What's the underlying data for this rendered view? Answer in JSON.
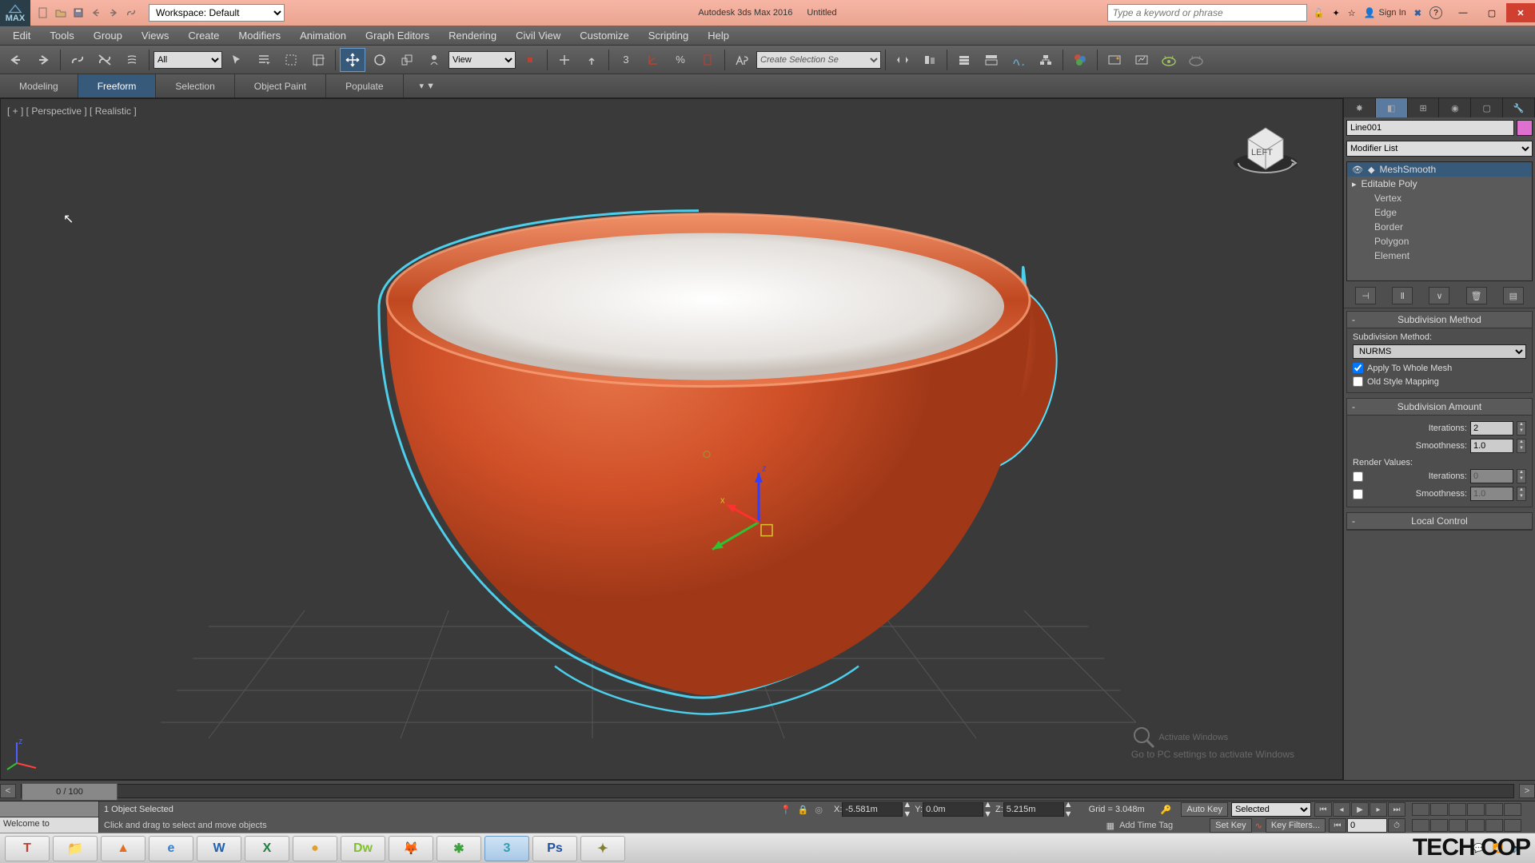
{
  "app": {
    "name": "Autodesk 3ds Max 2016",
    "doc": "Untitled",
    "logo": "MAX"
  },
  "workspace": {
    "label": "Workspace: Default"
  },
  "search": {
    "placeholder": "Type a keyword or phrase"
  },
  "signin": "Sign In",
  "menus": [
    "Edit",
    "Tools",
    "Group",
    "Views",
    "Create",
    "Modifiers",
    "Animation",
    "Graph Editors",
    "Rendering",
    "Civil View",
    "Customize",
    "Scripting",
    "Help"
  ],
  "toolbar": {
    "filter": "All",
    "refcoord": "View",
    "selset": "Create Selection Se"
  },
  "ribbon": [
    "Modeling",
    "Freeform",
    "Selection",
    "Object Paint",
    "Populate"
  ],
  "ribbon_active": 1,
  "viewport": {
    "label": "[ + ] [ Perspective ] [ Realistic ]"
  },
  "activate": {
    "title": "Activate Windows",
    "sub": "Go to PC settings to activate Windows"
  },
  "cpanel": {
    "object": "Line001",
    "modlist": "Modifier List",
    "stack": [
      {
        "label": "MeshSmooth",
        "sel": true,
        "eye": true
      },
      {
        "label": "Editable Poly",
        "expand": true
      },
      {
        "label": "Vertex",
        "sub": true
      },
      {
        "label": "Edge",
        "sub": true
      },
      {
        "label": "Border",
        "sub": true
      },
      {
        "label": "Polygon",
        "sub": true
      },
      {
        "label": "Element",
        "sub": true
      }
    ],
    "subdiv_method": {
      "title": "Subdivision Method",
      "label": "Subdivision Method:",
      "value": "NURMS",
      "apply": "Apply To Whole Mesh",
      "oldstyle": "Old Style Mapping"
    },
    "subdiv_amount": {
      "title": "Subdivision Amount",
      "iter_label": "Iterations:",
      "iter": "2",
      "smooth_label": "Smoothness:",
      "smooth": "1.0",
      "render_label": "Render Values:",
      "r_iter_label": "Iterations:",
      "r_iter": "0",
      "r_smooth_label": "Smoothness:",
      "r_smooth": "1.0"
    },
    "local": {
      "title": "Local Control"
    }
  },
  "time": {
    "frame": "0 / 100"
  },
  "status": {
    "welcome": "Welcome to",
    "selected": "1 Object Selected",
    "prompt": "Click and drag to select and move objects",
    "x": "-5.581m",
    "y": "0.0m",
    "z": "5.215m",
    "grid": "Grid = 3.048m",
    "autokey": "Auto Key",
    "setkey": "Set Key",
    "keymode": "Selected",
    "keyfilters": "Key Filters...",
    "curframe": "0",
    "addtag": "Add Time Tag"
  },
  "taskbar": {
    "apps": [
      {
        "name": "tally",
        "color": "#c04030",
        "txt": "T"
      },
      {
        "name": "explorer",
        "color": "#f0c050",
        "txt": "📁"
      },
      {
        "name": "vlc",
        "color": "#e07020",
        "txt": "▲"
      },
      {
        "name": "ie",
        "color": "#3080d0",
        "txt": "e"
      },
      {
        "name": "word",
        "color": "#2060b0",
        "txt": "W"
      },
      {
        "name": "excel",
        "color": "#208040",
        "txt": "X"
      },
      {
        "name": "chrome",
        "color": "#e0a030",
        "txt": "●"
      },
      {
        "name": "dreamweaver",
        "color": "#80c030",
        "txt": "Dw"
      },
      {
        "name": "firefox",
        "color": "#e06020",
        "txt": "🦊"
      },
      {
        "name": "corel",
        "color": "#40a040",
        "txt": "✱"
      },
      {
        "name": "3dsmax",
        "color": "#30a0b0",
        "txt": "3",
        "active": true
      },
      {
        "name": "photoshop",
        "color": "#2050a0",
        "txt": "Ps"
      },
      {
        "name": "app",
        "color": "#808030",
        "txt": "✦"
      }
    ],
    "watermark": "TECH COP"
  }
}
